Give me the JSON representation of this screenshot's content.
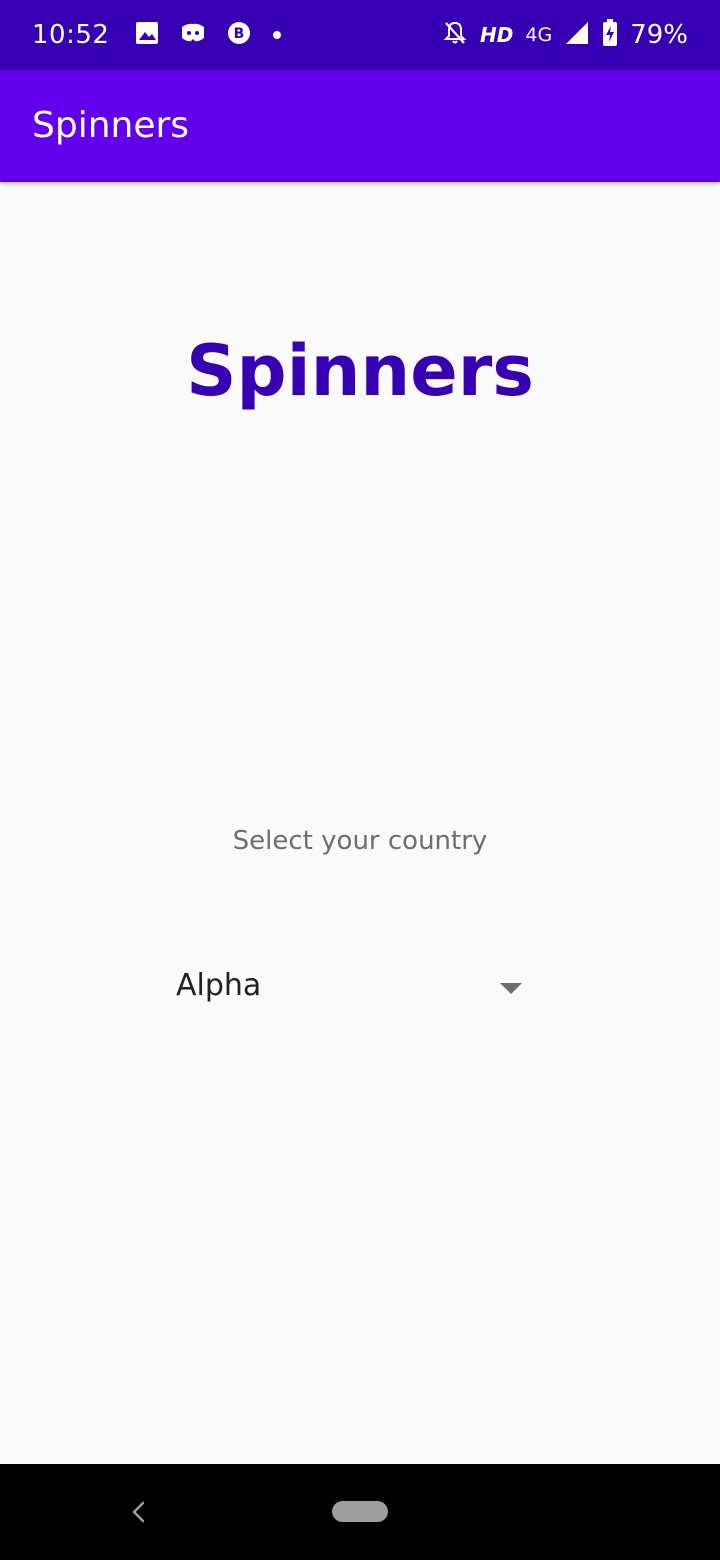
{
  "status_bar": {
    "time": "10:52",
    "hd": "HD",
    "network": "4G",
    "battery": "79%",
    "icons": [
      "image-icon",
      "discord-icon",
      "bitcoin-icon",
      "dot-icon",
      "bell-off-icon",
      "signal-icon",
      "battery-charging-icon"
    ]
  },
  "app_bar": {
    "title": "Spinners"
  },
  "main": {
    "heading": "Spinners",
    "label": "Select your country",
    "spinner": {
      "selected": "Alpha"
    }
  },
  "nav_bar": {
    "icons": [
      "back-icon",
      "home-pill"
    ]
  },
  "colors": {
    "status_bar": "#3700B3",
    "app_bar": "#6200EE",
    "heading": "#3700B3",
    "background": "#FAFAFA"
  }
}
